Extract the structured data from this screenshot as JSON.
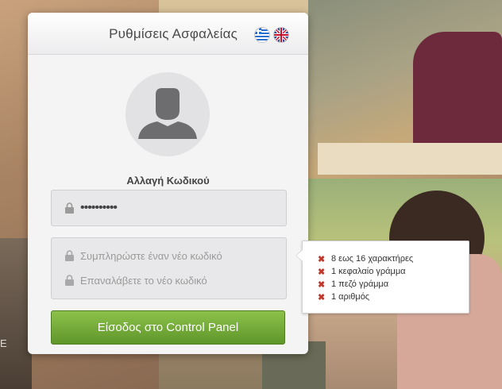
{
  "header": {
    "title": "Ρυθμίσεις Ασφαλείας"
  },
  "languages": [
    {
      "name": "greek-flag"
    },
    {
      "name": "uk-flag"
    }
  ],
  "form": {
    "subtitle": "Αλλαγή Κωδικού",
    "current_password_value": "••••••••••",
    "new_password_placeholder": "Συμπληρώστε έναν νέο κωδικό",
    "repeat_password_placeholder": "Επαναλάβετε το νέο κωδικό",
    "submit_label": "Είσοδος στο Control Panel"
  },
  "requirements": [
    {
      "mark": "✖",
      "text": "8 εως 16 χαρακτήρες"
    },
    {
      "mark": "✖",
      "text": "1 κεφαλαίο γράμμα"
    },
    {
      "mark": "✖",
      "text": "1 πεζό γράμμα"
    },
    {
      "mark": "✖",
      "text": "1 αριθμός"
    }
  ],
  "background_text": "E",
  "colors": {
    "accent_green": "#6fa934",
    "error_red": "#c0392b"
  }
}
